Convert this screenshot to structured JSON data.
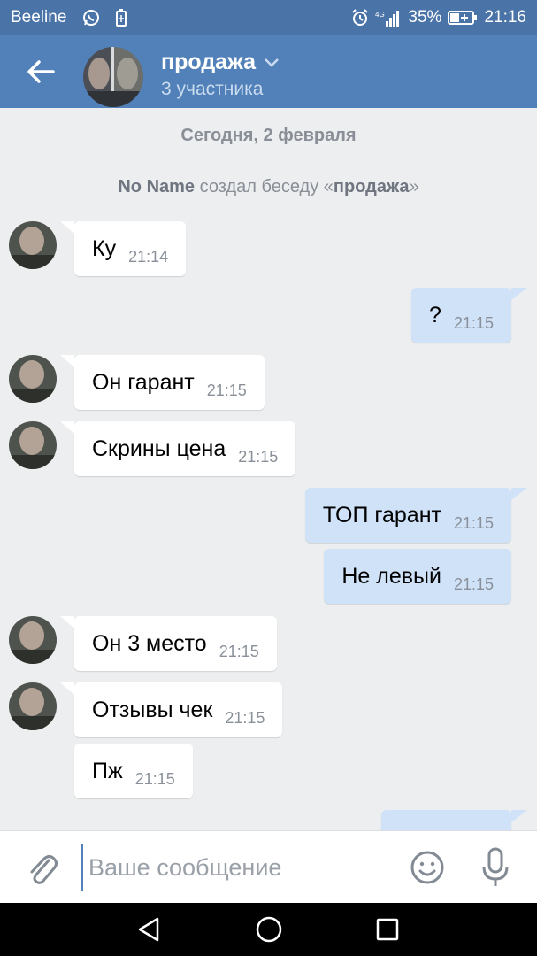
{
  "status_bar": {
    "carrier": "Beeline",
    "battery": "35%",
    "time": "21:16",
    "icons": [
      "whatsapp-icon",
      "battery-saver-icon",
      "alarm-icon",
      "signal-icon",
      "battery-charging-icon"
    ]
  },
  "header": {
    "title": "продажа",
    "subtitle": "3 участника",
    "back_icon": "arrow-left-icon",
    "dropdown_icon": "chevron-down-icon"
  },
  "conversation": {
    "date_separator": "Сегодня, 2 февраля",
    "service_message": {
      "actor": "No Name",
      "action": " создал беседу «",
      "chat_name": "продажа",
      "suffix": "»"
    },
    "messages": [
      {
        "direction": "in",
        "text": "Ку",
        "time": "21:14"
      },
      {
        "direction": "out",
        "text": "?",
        "time": "21:15"
      },
      {
        "direction": "in",
        "text": "Он гарант",
        "time": "21:15"
      },
      {
        "direction": "in",
        "text": "Скрины цена",
        "time": "21:15"
      },
      {
        "direction": "out",
        "text": "ТОП гарант",
        "time": "21:15"
      },
      {
        "direction": "out",
        "text": "Не левый",
        "time": "21:15"
      },
      {
        "direction": "in",
        "text": "Он 3 место",
        "time": "21:15"
      },
      {
        "direction": "in",
        "text": "Отзывы чек",
        "time": "21:15"
      },
      {
        "direction": "in",
        "text": "Пж",
        "time": "21:15"
      }
    ]
  },
  "composer": {
    "placeholder": "Ваше сообщение",
    "value": "",
    "icons": [
      "paperclip-icon",
      "emoji-icon",
      "microphone-icon"
    ]
  },
  "nav_bar": {
    "icons": [
      "back-triangle-icon",
      "home-circle-icon",
      "recents-square-icon"
    ]
  },
  "colors": {
    "header": "#5181b8",
    "status_bar": "#4a73a8",
    "background": "#edeef0",
    "incoming_bubble": "#ffffff",
    "outgoing_bubble": "#cfe2f8"
  }
}
